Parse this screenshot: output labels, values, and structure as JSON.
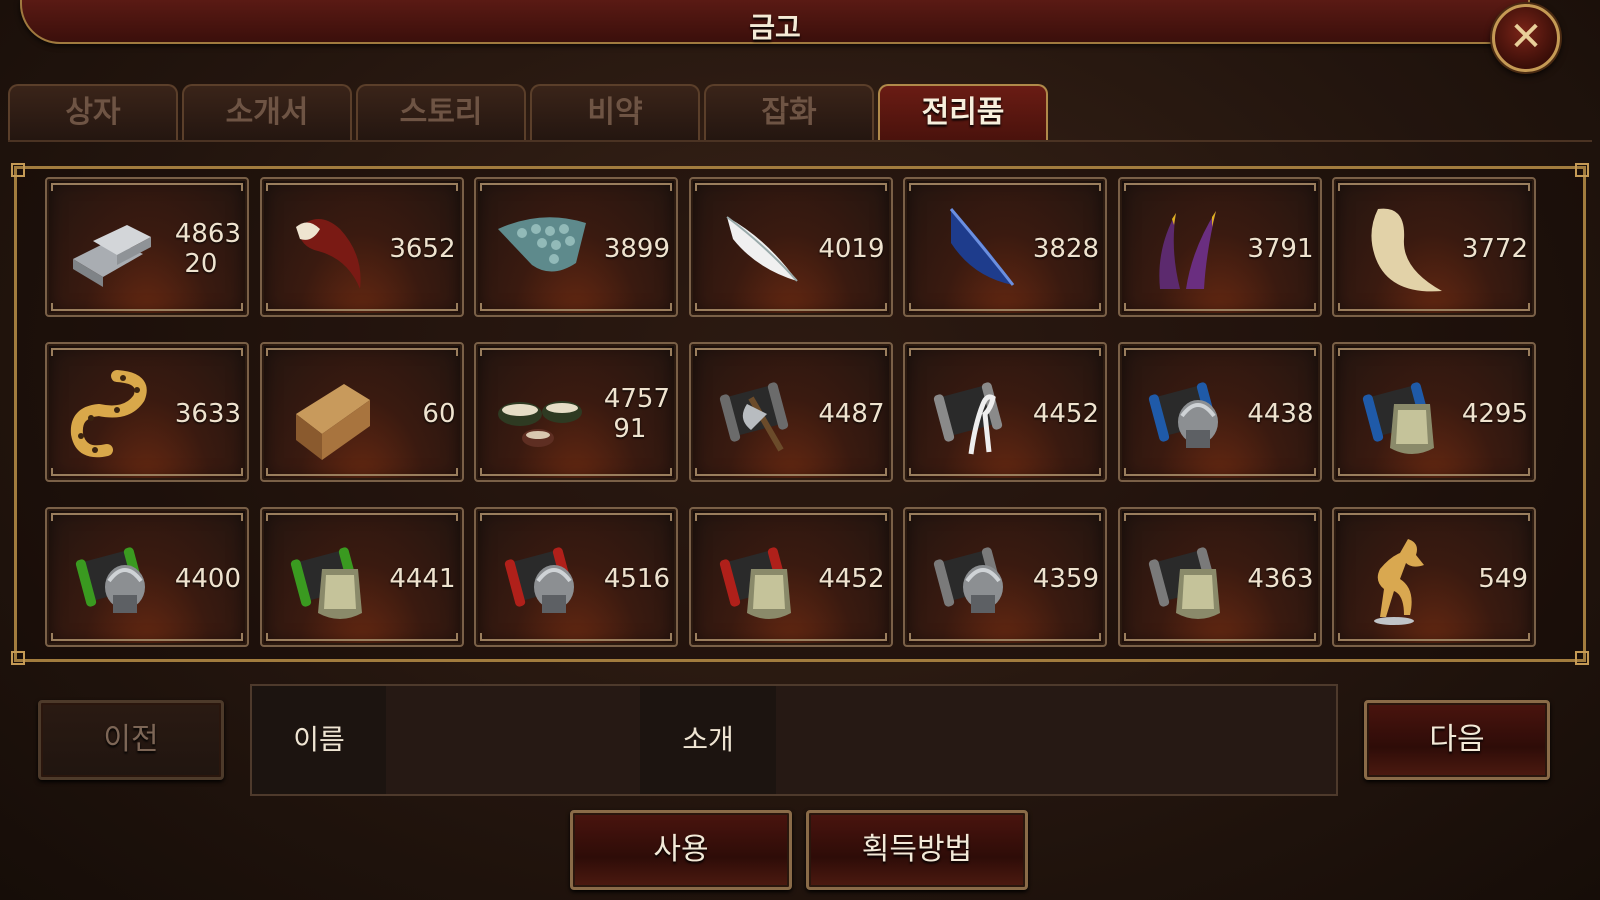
{
  "window": {
    "title": "금고",
    "close_icon": "close-x-icon"
  },
  "tabs": [
    {
      "label": "상자",
      "active": false
    },
    {
      "label": "소개서",
      "active": false
    },
    {
      "label": "스토리",
      "active": false
    },
    {
      "label": "비약",
      "active": false
    },
    {
      "label": "잡화",
      "active": false
    },
    {
      "label": "전리품",
      "active": true
    }
  ],
  "items": [
    {
      "icon": "silver-ingots-icon",
      "count": "4863",
      "count_line2": "20"
    },
    {
      "icon": "beast-claw-icon",
      "count": "3652"
    },
    {
      "icon": "scale-armor-icon",
      "count": "3899"
    },
    {
      "icon": "white-feather-icon",
      "count": "4019"
    },
    {
      "icon": "blue-feather-icon",
      "count": "3828"
    },
    {
      "icon": "purple-horns-icon",
      "count": "3791"
    },
    {
      "icon": "tusk-icon",
      "count": "3772"
    },
    {
      "icon": "leopard-tail-icon",
      "count": "3633"
    },
    {
      "icon": "wooden-chest-icon",
      "count": "60"
    },
    {
      "icon": "tea-bowls-icon",
      "count": "4757",
      "count_line2": "91"
    },
    {
      "icon": "scroll-axe-icon",
      "count": "4487"
    },
    {
      "icon": "scroll-crane-icon",
      "count": "4452"
    },
    {
      "icon": "blue-scroll-helmet-icon",
      "count": "4438"
    },
    {
      "icon": "blue-scroll-armor-icon",
      "count": "4295"
    },
    {
      "icon": "green-scroll-helmet-icon",
      "count": "4400"
    },
    {
      "icon": "green-scroll-armor-icon",
      "count": "4441"
    },
    {
      "icon": "red-scroll-helmet-icon",
      "count": "4516"
    },
    {
      "icon": "red-scroll-armor-icon",
      "count": "4452"
    },
    {
      "icon": "grey-scroll-helmet-icon",
      "count": "4359"
    },
    {
      "icon": "grey-scroll-armor-icon",
      "count": "4363"
    },
    {
      "icon": "golden-horse-icon",
      "count": "549"
    }
  ],
  "footer": {
    "prev_label": "이전",
    "next_label": "다음",
    "name_label": "이름",
    "desc_label": "소개",
    "use_label": "사용",
    "acquire_label": "획득방법"
  },
  "colors": {
    "accent_gold": "#a27c3e",
    "active_tab": "#6a1c14",
    "title_bar": "#5a1a14"
  }
}
